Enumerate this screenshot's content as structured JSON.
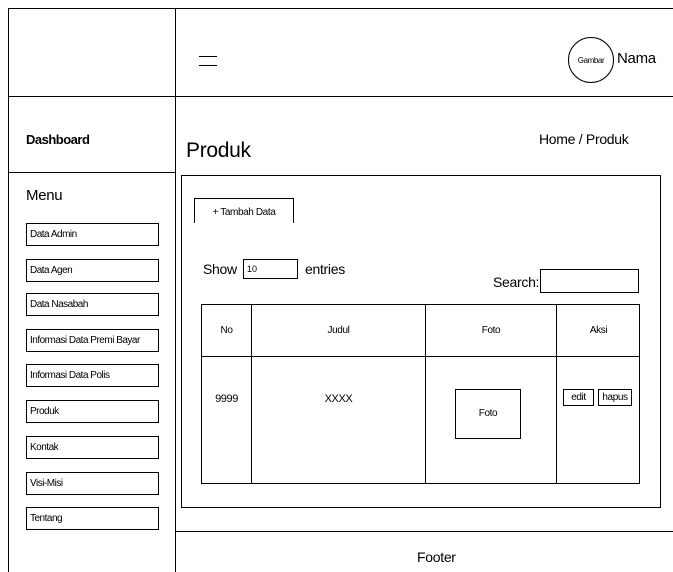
{
  "header": {
    "user_avatar_label": "Gambar",
    "user_name": "Nama"
  },
  "sidebar": {
    "brand": "Dashboard",
    "menu_title": "Menu",
    "items": [
      {
        "label": "Data Admin"
      },
      {
        "label": "Data Agen"
      },
      {
        "label": "Data Nasabah"
      },
      {
        "label": "Informasi Data Premi Bayar"
      },
      {
        "label": "Informasi Data Polis"
      },
      {
        "label": "Produk"
      },
      {
        "label": "Kontak"
      },
      {
        "label": "Visi-Misi"
      },
      {
        "label": "Tentang"
      }
    ]
  },
  "main": {
    "page_title": "Produk",
    "breadcrumb": "Home / Produk",
    "add_button": "+ Tambah Data",
    "show_label": "Show",
    "entries_value": "10",
    "entries_label": "entries",
    "search_label": "Search:",
    "search_value": "",
    "table": {
      "headers": [
        "No",
        "Judul",
        "Foto",
        "Aksi"
      ],
      "rows": [
        {
          "no": "9999",
          "judul": "XXXX",
          "foto": "Foto",
          "edit": "edit",
          "hapus": "hapus"
        }
      ]
    }
  },
  "footer": {
    "text": "Footer"
  }
}
